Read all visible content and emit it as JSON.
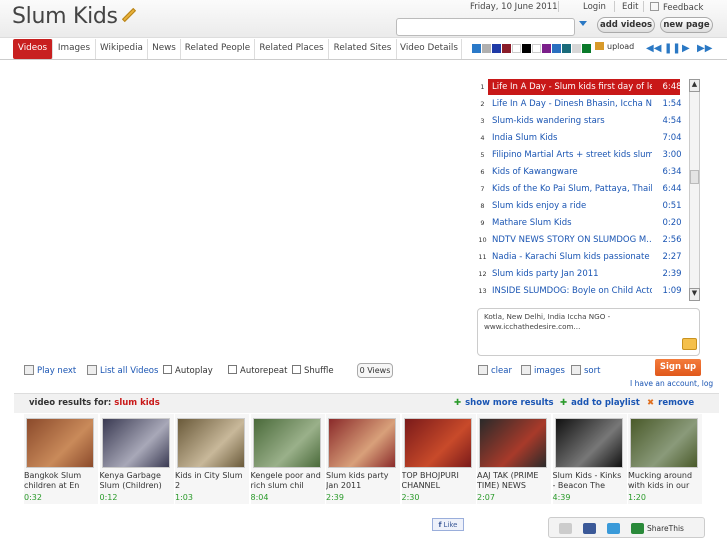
{
  "header": {
    "title": "Slum Kids",
    "date": "Friday, 10 June 2011",
    "login": "Login",
    "edit": "Edit",
    "feedback": "Feedback",
    "add_videos": "add videos",
    "new_page": "new page"
  },
  "tabs": [
    "Videos",
    "Images",
    "Wikipedia",
    "News",
    "Related People",
    "Related Places",
    "Related Sites",
    "Video Details"
  ],
  "colors": [
    "#2a79c8",
    "#b0b0b0",
    "#1f3aa6",
    "#8a1d2a",
    "#ffffff",
    "#000000",
    "#ffffff",
    "#7b1f8a",
    "#2a6fbf",
    "#1a6b7a",
    "#d7d7d7",
    "#0a7a2a"
  ],
  "controls": {
    "upload": "upload"
  },
  "playlist": [
    {
      "n": "1",
      "title": "Life In A Day - Slum kids first day of lear...",
      "dur": "6:48",
      "selected": true
    },
    {
      "n": "2",
      "title": "Life In A Day - Dinesh Bhasin, Iccha NG...",
      "dur": "1:54"
    },
    {
      "n": "3",
      "title": "Slum-kids wandering stars",
      "dur": "4:54"
    },
    {
      "n": "4",
      "title": "India Slum Kids",
      "dur": "7:04"
    },
    {
      "n": "5",
      "title": "Filipino Martial Arts + street kids slum vil...",
      "dur": "3:00"
    },
    {
      "n": "6",
      "title": "Kids of Kawangware",
      "dur": "6:34"
    },
    {
      "n": "7",
      "title": "Kids of the Ko Pai Slum, Pattaya, Thaila...",
      "dur": "6:44"
    },
    {
      "n": "8",
      "title": "Slum kids enjoy a ride",
      "dur": "0:51"
    },
    {
      "n": "9",
      "title": "Mathare Slum Kids",
      "dur": "0:20"
    },
    {
      "n": "10",
      "title": "NDTV NEWS STORY ON SLUMDOG M...",
      "dur": "2:56"
    },
    {
      "n": "11",
      "title": "Nadia - Karachi Slum kids passionate sp...",
      "dur": "2:27"
    },
    {
      "n": "12",
      "title": "Slum kids party Jan 2011",
      "dur": "2:39"
    },
    {
      "n": "13",
      "title": "INSIDE SLUMDOG: Boyle on Child Acto...",
      "dur": "1:09"
    }
  ],
  "description": "Kotla, New Delhi, India Iccha NGO - www.icchathedesire.com...",
  "actions": {
    "clear": "clear",
    "images": "images",
    "sort": "sort",
    "signup": "Sign up",
    "account": "I have an account, log"
  },
  "player": {
    "play_next": "Play next",
    "list_all": "List all Videos",
    "autoplay": "Autoplay",
    "autorepeat": "Autorepeat",
    "shuffle": "Shuffle",
    "views": "0 Views"
  },
  "results": {
    "label": "video results for:",
    "query": "slum kids",
    "show_more": "show more results",
    "add_playlist": "add to playlist",
    "remove": "remove"
  },
  "thumbs": [
    {
      "caption": "Bangkok Slum children at En",
      "dur": "0:32",
      "c1": "#8b4a2b",
      "c2": "#c98a5a"
    },
    {
      "caption": "Kenya Garbage Slum (Children)",
      "dur": "0:12",
      "c1": "#3a3a52",
      "c2": "#a8a8b8"
    },
    {
      "caption": "Kids in City Slum 2",
      "dur": "1:03",
      "c1": "#6a5a3a",
      "c2": "#c8b89a"
    },
    {
      "caption": "Kengele poor and rich slum chil",
      "dur": "8:04",
      "c1": "#4a6a3a",
      "c2": "#9ab08a"
    },
    {
      "caption": "Slum kids party Jan 2011",
      "dur": "2:39",
      "c1": "#8a2a2a",
      "c2": "#d8a07a"
    },
    {
      "caption": "TOP BHOJPURI CHANNEL",
      "dur": "2:30",
      "c1": "#7a1a1a",
      "c2": "#c84a2a"
    },
    {
      "caption": "AAJ TAK (PRIME TIME) NEWS",
      "dur": "2:07",
      "c1": "#2a2a2a",
      "c2": "#a83a2a"
    },
    {
      "caption": "Slum Kids - Kinks - Beacon The",
      "dur": "4:39",
      "c1": "#111111",
      "c2": "#777777"
    },
    {
      "caption": "Mucking around with kids in our",
      "dur": "1:20",
      "c1": "#4a5a2a",
      "c2": "#8a9a7a"
    }
  ],
  "footer": {
    "like": "Like",
    "sharethis": "ShareThis"
  }
}
